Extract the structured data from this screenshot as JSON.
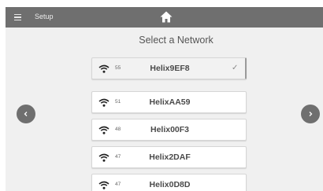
{
  "header": {
    "title": "Setup",
    "menu_icon": "hamburger-menu-icon",
    "home_icon": "home-icon"
  },
  "heading": "Select a Network",
  "networks": [
    {
      "strength": "55",
      "ssid": "Helix9EF8",
      "selected": true
    },
    {
      "strength": "51",
      "ssid": "HelixAA59",
      "selected": false
    },
    {
      "strength": "48",
      "ssid": "Helix00F3",
      "selected": false
    },
    {
      "strength": "47",
      "ssid": "Helix2DAF",
      "selected": false
    },
    {
      "strength": "47",
      "ssid": "Helix0D8D",
      "selected": false
    }
  ],
  "nav": {
    "prev_icon": "chevron-left-icon",
    "next_icon": "chevron-right-icon"
  },
  "colors": {
    "topbar": "#6f6f6f",
    "background": "#f0f0f0",
    "row": "#ffffff",
    "text": "#4a4a4a"
  }
}
